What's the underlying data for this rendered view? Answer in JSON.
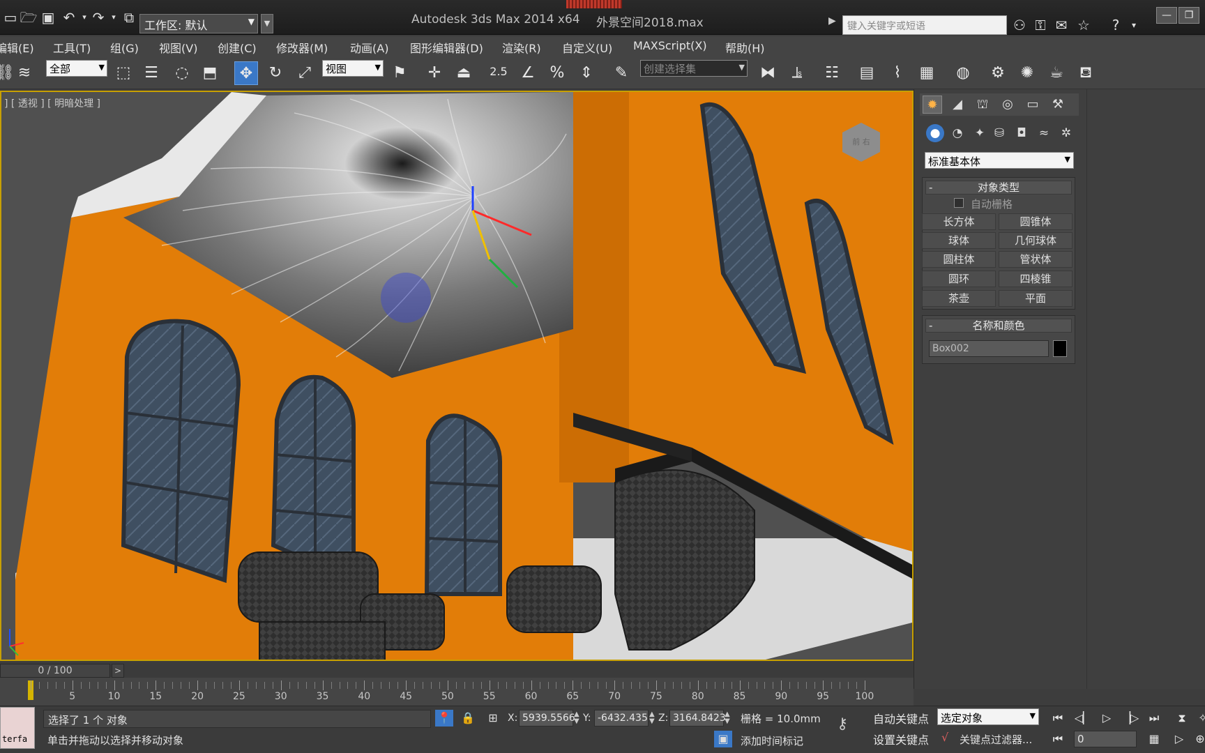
{
  "titlebar": {
    "workspace_label": "工作区: 默认",
    "app_title": "Autodesk 3ds Max  2014 x64",
    "file_name": "外景空间2018.max",
    "search_placeholder": "键入关键字或短语",
    "minimize_label": "—"
  },
  "menu": [
    "编辑(E)",
    "工具(T)",
    "组(G)",
    "视图(V)",
    "创建(C)",
    "修改器(M)",
    "动画(A)",
    "图形编辑器(D)",
    "渲染(R)",
    "自定义(U)",
    "MAXScript(X)",
    "帮助(H)"
  ],
  "toolbar": {
    "selection_filter": "全部",
    "ref_coord": "视图",
    "snap_value": "2.5",
    "named_selection": "创建选择集"
  },
  "viewport": {
    "label": "] [ 透视 ] [ 明暗处理 ]",
    "viewcube_label": "前 右"
  },
  "command_panel": {
    "category": "标准基本体",
    "object_type_title": "对象类型",
    "autogrid": "自动栅格",
    "buttons": [
      "长方体",
      "圆锥体",
      "球体",
      "几何球体",
      "圆柱体",
      "管状体",
      "圆环",
      "四棱锥",
      "茶壶",
      "平面"
    ],
    "name_color_title": "名称和颜色",
    "object_name": "Box002",
    "object_color": "#000000",
    "rollout_minus": "-"
  },
  "timeline": {
    "frame_counter": "0 / 100",
    "next": ">",
    "tick_labels": [
      "5",
      "10",
      "15",
      "20",
      "25",
      "30",
      "35",
      "40",
      "45",
      "50",
      "55",
      "60",
      "65",
      "70",
      "75",
      "80",
      "85",
      "90",
      "95",
      "100"
    ]
  },
  "status": {
    "maxscript_text": "terfa",
    "selection_message": "选择了 1 个 对象",
    "prompt_message": "单击并拖动以选择并移动对象",
    "x_label": "X:",
    "x_value": "5939.5566",
    "y_label": "Y:",
    "y_value": "-6432.435",
    "z_label": "Z:",
    "z_value": "3164.8423",
    "grid": "栅格 = 10.0mm",
    "add_time_tag": "添加时间标记",
    "auto_key": "自动关键点",
    "set_key": "设置关键点",
    "selection_set": "选定对象",
    "key_filters": "关键点过滤器...",
    "current_frame": "0"
  },
  "colors": {
    "wall_orange": "#e27d08",
    "active_blue": "#3a78c7",
    "viewport_border": "#c8a000"
  }
}
